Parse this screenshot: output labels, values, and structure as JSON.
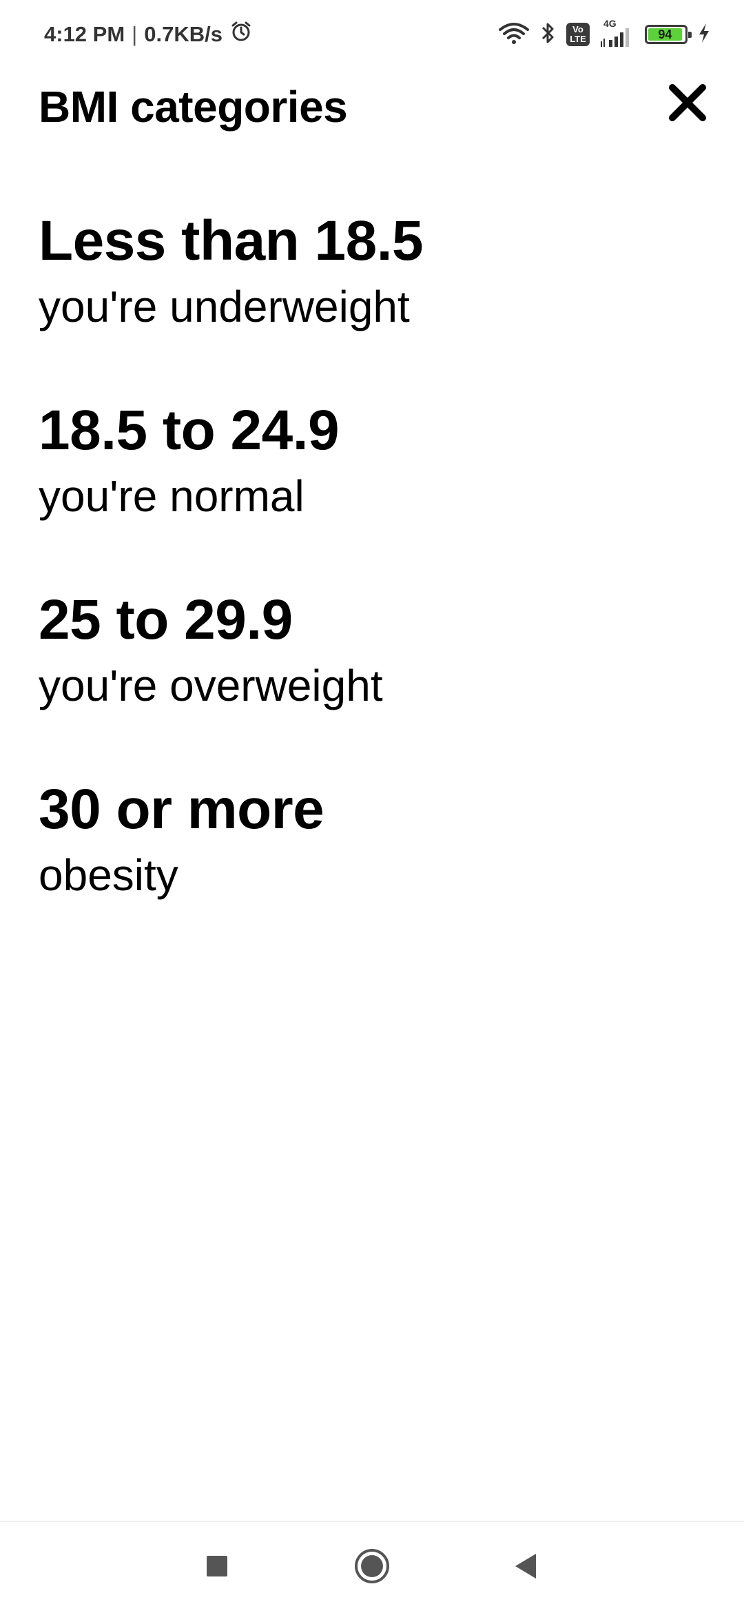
{
  "status_bar": {
    "time": "4:12 PM",
    "separator": "|",
    "network_speed": "0.7KB/s",
    "alarm_icon": "alarm-clock-icon",
    "wifi_icon": "wifi-icon",
    "bluetooth_icon": "bluetooth-icon",
    "volte_top": "Vo",
    "volte_bottom": "LTE",
    "network_type": "4G",
    "signal_icon": "cellular-signal-icon",
    "battery_level": "94",
    "battery_fraction": 0.94,
    "charging_icon": "charging-bolt-icon",
    "battery_color": "#5dd13a"
  },
  "header": {
    "title": "BMI categories",
    "close_icon": "close-icon"
  },
  "categories": [
    {
      "range": "Less than 18.5",
      "description": "you're underweight"
    },
    {
      "range": "18.5 to 24.9",
      "description": "you're normal"
    },
    {
      "range": "25 to 29.9",
      "description": "you're overweight"
    },
    {
      "range": "30 or more",
      "description": "obesity"
    }
  ],
  "nav_bar": {
    "recents_icon": "square-recents-icon",
    "home_icon": "circle-home-icon",
    "back_icon": "triangle-back-icon"
  }
}
